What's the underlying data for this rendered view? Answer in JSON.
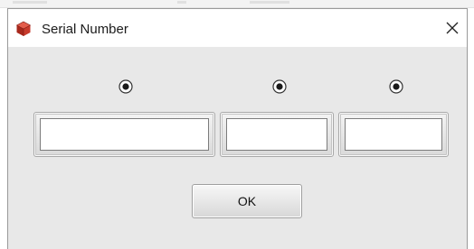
{
  "window": {
    "title": "Serial Number",
    "icon": "app-cube-icon",
    "close_glyph": "×"
  },
  "serial_fields": [
    {
      "selected": true,
      "value": ""
    },
    {
      "selected": true,
      "value": ""
    },
    {
      "selected": true,
      "value": ""
    }
  ],
  "ok_label": "OK",
  "colors": {
    "dialog_background": "#e8e8e8",
    "titlebar_background": "#ffffff",
    "icon_red": "#c0392b"
  }
}
